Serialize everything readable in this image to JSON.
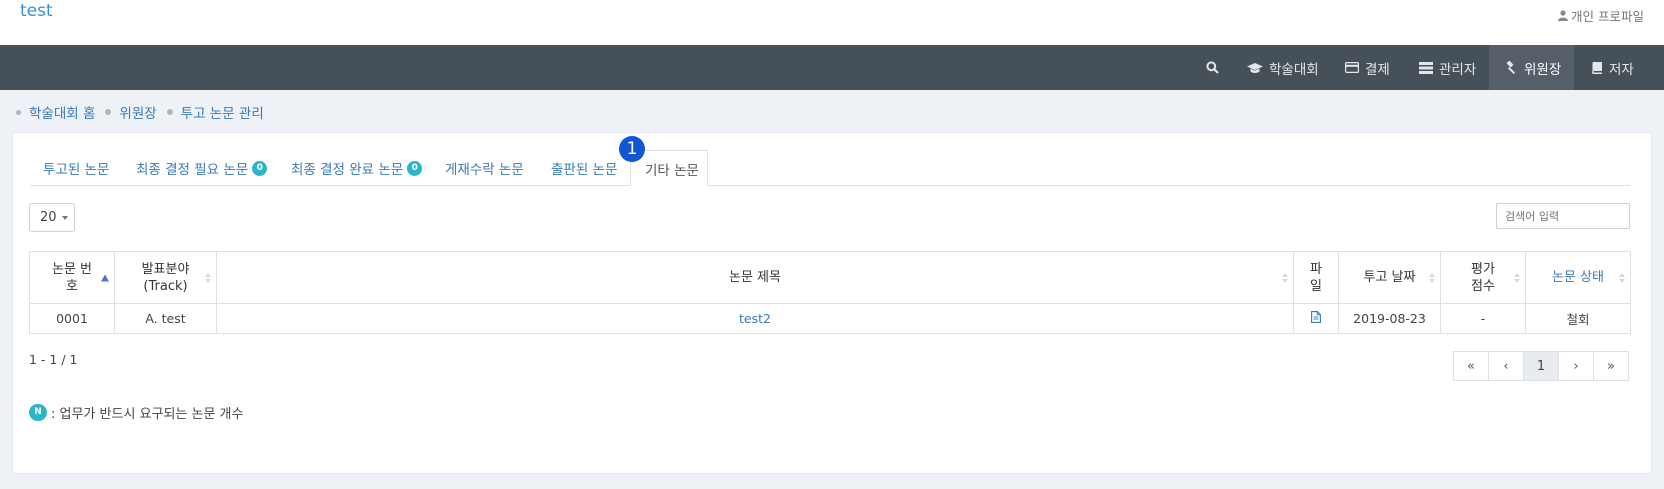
{
  "app": {
    "brand": "test",
    "profile_label": "개인 프로파일"
  },
  "nav": {
    "items": [
      {
        "label": "학술대회",
        "icon": "graduation-cap-icon"
      },
      {
        "label": "결제",
        "icon": "credit-card-icon"
      },
      {
        "label": "관리자",
        "icon": "server-icon"
      },
      {
        "label": "위원장",
        "icon": "gavel-icon",
        "active": true
      },
      {
        "label": "저자",
        "icon": "book-icon"
      }
    ],
    "search_icon": "search-icon"
  },
  "breadcrumb": [
    "학술대회 홈",
    "위원장",
    "투고 논문 관리"
  ],
  "tabs": [
    {
      "label": "투고된 논문"
    },
    {
      "label": "최종 결정 필요 논문",
      "badge": "0"
    },
    {
      "label": "최종 결정 완료 논문",
      "badge": "0"
    },
    {
      "label": "게재수락 논문"
    },
    {
      "label": "출판된 논문"
    },
    {
      "label": "기타 논문",
      "active": true
    }
  ],
  "step_marker": "1",
  "page_size": "20",
  "search": {
    "placeholder": "검색어 입력"
  },
  "table": {
    "headers": {
      "number_l1": "논문 번",
      "number_l2": "호",
      "track_l1": "발표분야",
      "track_l2": "(Track)",
      "title": "논문 제목",
      "file_l1": "파",
      "file_l2": "일",
      "date": "투고 날짜",
      "score_l1": "평가",
      "score_l2": "점수",
      "status": "논문 상태"
    },
    "rows": [
      {
        "number": "0001",
        "track": "A. test",
        "title": "test2",
        "file_icon": "file-icon",
        "date": "2019-08-23",
        "score": "-",
        "status": "철회"
      }
    ]
  },
  "count_text": "1 - 1 / 1",
  "pagination": {
    "first": "«",
    "prev": "‹",
    "current": "1",
    "next": "›",
    "last": "»"
  },
  "legend": {
    "badge": "N",
    "text": ": 업무가 반드시 요구되는 논문 개수"
  },
  "colors": {
    "navbar": "#465059",
    "accent": "#3a7ab8",
    "badge": "#2cb5c8",
    "step_marker": "#1256d6"
  }
}
